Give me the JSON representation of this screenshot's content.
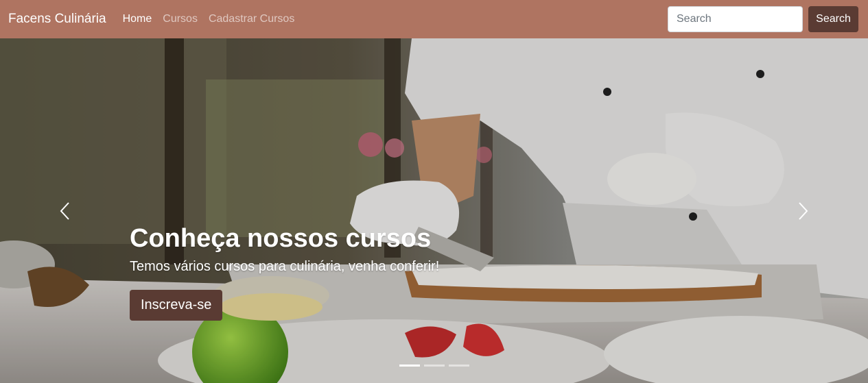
{
  "navbar": {
    "brand": "Facens Culinária",
    "links": [
      {
        "label": "Home",
        "active": true
      },
      {
        "label": "Cursos",
        "active": false
      },
      {
        "label": "Cadastrar Cursos",
        "active": false
      }
    ],
    "search": {
      "placeholder": "Search",
      "value": "",
      "button_label": "Search"
    }
  },
  "carousel": {
    "slide": {
      "title": "Conheça nossos cursos",
      "text": "Temos vários cursos para culinária, venha conferir!",
      "button_label": "Inscreva-se"
    },
    "prev_icon": "chevron-left-icon",
    "next_icon": "chevron-right-icon",
    "indicators": [
      true,
      false,
      false
    ]
  },
  "colors": {
    "navbar_bg": "#af7461",
    "button_bg": "#5a3b33",
    "text_light": "#ffffff"
  }
}
